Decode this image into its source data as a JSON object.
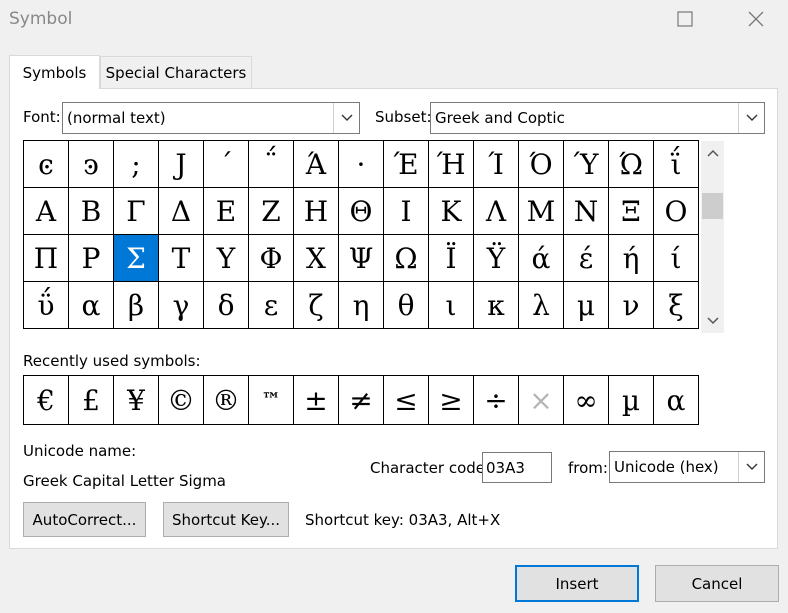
{
  "window": {
    "title": "Symbol"
  },
  "tabs": [
    {
      "label": "Symbols",
      "active": true
    },
    {
      "label": "Special Characters",
      "active": false
    }
  ],
  "font": {
    "label": "Font:",
    "value": "(normal text)"
  },
  "subset": {
    "label": "Subset:",
    "value": "Greek and Coptic"
  },
  "symbols": [
    "ͼ",
    "ͽ",
    ";",
    "Ϳ",
    "΄",
    "΅",
    "Ά",
    "·",
    "Έ",
    "Ή",
    "Ί",
    "Ό",
    "Ύ",
    "Ώ",
    "ΐ",
    "Α",
    "Β",
    "Γ",
    "Δ",
    "Ε",
    "Ζ",
    "Η",
    "Θ",
    "Ι",
    "Κ",
    "Λ",
    "Μ",
    "Ν",
    "Ξ",
    "Ο",
    "Π",
    "Ρ",
    "Σ",
    "Τ",
    "Υ",
    "Φ",
    "Χ",
    "Ψ",
    "Ω",
    "Ϊ",
    "Ϋ",
    "ά",
    "έ",
    "ή",
    "ί",
    "ΰ",
    "α",
    "β",
    "γ",
    "δ",
    "ε",
    "ζ",
    "η",
    "θ",
    "ι",
    "κ",
    "λ",
    "μ",
    "ν",
    "ξ"
  ],
  "selected_symbol": "Σ",
  "recently_used": {
    "label": "Recently used symbols:",
    "symbols": [
      "€",
      "£",
      "¥",
      "©",
      "®",
      "™",
      "±",
      "≠",
      "≤",
      "≥",
      "÷",
      "×",
      "∞",
      "µ",
      "α"
    ]
  },
  "unicode": {
    "label": "Unicode name:",
    "name": "Greek Capital Letter Sigma"
  },
  "character_code": {
    "label": "Character code:",
    "value": "03A3"
  },
  "from": {
    "label": "from:",
    "value": "Unicode (hex)"
  },
  "buttons": {
    "autocorrect": "AutoCorrect...",
    "shortcut_key": "Shortcut Key...",
    "insert": "Insert",
    "cancel": "Cancel"
  },
  "shortcut_text": "Shortcut key: 03A3, Alt+X",
  "colors": {
    "selection": "#0078d7",
    "default_button_border": "#0078d7"
  }
}
